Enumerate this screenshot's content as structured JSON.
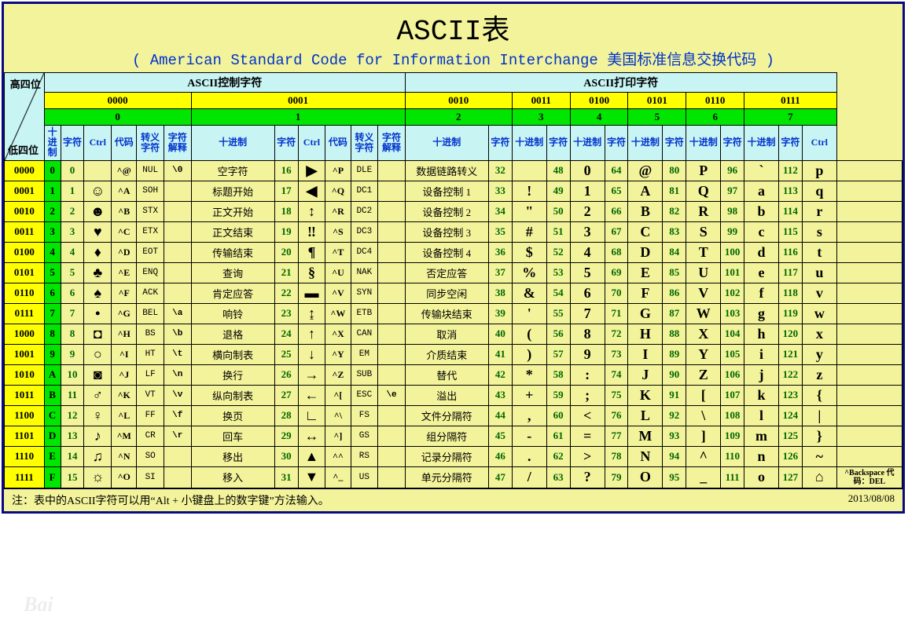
{
  "title": "ASCII表",
  "subtitle": "( American Standard Code for Information Interchange  美国标准信息交换代码 )",
  "corner_hi": "高四位",
  "corner_lo": "低四位",
  "section_control": "ASCII控制字符",
  "section_print": "ASCII打印字符",
  "bins": [
    "0000",
    "0001",
    "0010",
    "0011",
    "0100",
    "0101",
    "0110",
    "0111"
  ],
  "hexes": [
    "0",
    "1",
    "2",
    "3",
    "4",
    "5",
    "6",
    "7"
  ],
  "h": {
    "dec": "十进制",
    "char": "字符",
    "ctrl": "Ctrl",
    "code": "代码",
    "esc": "转义字符",
    "desc": "字符解释"
  },
  "rows_meta": [
    {
      "bin": "0000",
      "hex": "0"
    },
    {
      "bin": "0001",
      "hex": "1"
    },
    {
      "bin": "0010",
      "hex": "2"
    },
    {
      "bin": "0011",
      "hex": "3"
    },
    {
      "bin": "0100",
      "hex": "4"
    },
    {
      "bin": "0101",
      "hex": "5"
    },
    {
      "bin": "0110",
      "hex": "6"
    },
    {
      "bin": "0111",
      "hex": "7"
    },
    {
      "bin": "1000",
      "hex": "8"
    },
    {
      "bin": "1001",
      "hex": "9"
    },
    {
      "bin": "1010",
      "hex": "A"
    },
    {
      "bin": "1011",
      "hex": "B"
    },
    {
      "bin": "1100",
      "hex": "C"
    },
    {
      "bin": "1101",
      "hex": "D"
    },
    {
      "bin": "1110",
      "hex": "E"
    },
    {
      "bin": "1111",
      "hex": "F"
    }
  ],
  "col0": [
    {
      "d": 0,
      "g": "",
      "c": "^@",
      "cd": "NUL",
      "e": "\\0",
      "ds": "空字符"
    },
    {
      "d": 1,
      "g": "☺",
      "c": "^A",
      "cd": "SOH",
      "e": "",
      "ds": "标题开始"
    },
    {
      "d": 2,
      "g": "☻",
      "c": "^B",
      "cd": "STX",
      "e": "",
      "ds": "正文开始"
    },
    {
      "d": 3,
      "g": "♥",
      "c": "^C",
      "cd": "ETX",
      "e": "",
      "ds": "正文结束"
    },
    {
      "d": 4,
      "g": "♦",
      "c": "^D",
      "cd": "EOT",
      "e": "",
      "ds": "传输结束"
    },
    {
      "d": 5,
      "g": "♣",
      "c": "^E",
      "cd": "ENQ",
      "e": "",
      "ds": "查询"
    },
    {
      "d": 6,
      "g": "♠",
      "c": "^F",
      "cd": "ACK",
      "e": "",
      "ds": "肯定应答"
    },
    {
      "d": 7,
      "g": "•",
      "c": "^G",
      "cd": "BEL",
      "e": "\\a",
      "ds": "响铃"
    },
    {
      "d": 8,
      "g": "◘",
      "c": "^H",
      "cd": "BS",
      "e": "\\b",
      "ds": "退格"
    },
    {
      "d": 9,
      "g": "○",
      "c": "^I",
      "cd": "HT",
      "e": "\\t",
      "ds": "横向制表"
    },
    {
      "d": 10,
      "g": "◙",
      "c": "^J",
      "cd": "LF",
      "e": "\\n",
      "ds": "换行"
    },
    {
      "d": 11,
      "g": "♂",
      "c": "^K",
      "cd": "VT",
      "e": "\\v",
      "ds": "纵向制表"
    },
    {
      "d": 12,
      "g": "♀",
      "c": "^L",
      "cd": "FF",
      "e": "\\f",
      "ds": "换页"
    },
    {
      "d": 13,
      "g": "♪",
      "c": "^M",
      "cd": "CR",
      "e": "\\r",
      "ds": "回车"
    },
    {
      "d": 14,
      "g": "♫",
      "c": "^N",
      "cd": "SO",
      "e": "",
      "ds": "移出"
    },
    {
      "d": 15,
      "g": "☼",
      "c": "^O",
      "cd": "SI",
      "e": "",
      "ds": "移入"
    }
  ],
  "col1": [
    {
      "d": 16,
      "g": "▶",
      "c": "^P",
      "cd": "DLE",
      "e": "",
      "ds": "数据链路转义"
    },
    {
      "d": 17,
      "g": "◀",
      "c": "^Q",
      "cd": "DC1",
      "e": "",
      "ds": "设备控制 1"
    },
    {
      "d": 18,
      "g": "↕",
      "c": "^R",
      "cd": "DC2",
      "e": "",
      "ds": "设备控制 2"
    },
    {
      "d": 19,
      "g": "‼",
      "c": "^S",
      "cd": "DC3",
      "e": "",
      "ds": "设备控制 3"
    },
    {
      "d": 20,
      "g": "¶",
      "c": "^T",
      "cd": "DC4",
      "e": "",
      "ds": "设备控制 4"
    },
    {
      "d": 21,
      "g": "§",
      "c": "^U",
      "cd": "NAK",
      "e": "",
      "ds": "否定应答"
    },
    {
      "d": 22,
      "g": "▬",
      "c": "^V",
      "cd": "SYN",
      "e": "",
      "ds": "同步空闲"
    },
    {
      "d": 23,
      "g": "↨",
      "c": "^W",
      "cd": "ETB",
      "e": "",
      "ds": "传输块结束"
    },
    {
      "d": 24,
      "g": "↑",
      "c": "^X",
      "cd": "CAN",
      "e": "",
      "ds": "取消"
    },
    {
      "d": 25,
      "g": "↓",
      "c": "^Y",
      "cd": "EM",
      "e": "",
      "ds": "介质结束"
    },
    {
      "d": 26,
      "g": "→",
      "c": "^Z",
      "cd": "SUB",
      "e": "",
      "ds": "替代"
    },
    {
      "d": 27,
      "g": "←",
      "c": "^[",
      "cd": "ESC",
      "e": "\\e",
      "ds": "溢出"
    },
    {
      "d": 28,
      "g": "∟",
      "c": "^\\",
      "cd": "FS",
      "e": "",
      "ds": "文件分隔符"
    },
    {
      "d": 29,
      "g": "↔",
      "c": "^]",
      "cd": "GS",
      "e": "",
      "ds": "组分隔符"
    },
    {
      "d": 30,
      "g": "▲",
      "c": "^^",
      "cd": "RS",
      "e": "",
      "ds": "记录分隔符"
    },
    {
      "d": 31,
      "g": "▼",
      "c": "^_",
      "cd": "US",
      "e": "",
      "ds": "单元分隔符"
    }
  ],
  "col2": [
    {
      "d": 32,
      "g": ""
    },
    {
      "d": 33,
      "g": "!"
    },
    {
      "d": 34,
      "g": "\""
    },
    {
      "d": 35,
      "g": "#"
    },
    {
      "d": 36,
      "g": "$"
    },
    {
      "d": 37,
      "g": "%"
    },
    {
      "d": 38,
      "g": "&"
    },
    {
      "d": 39,
      "g": "'"
    },
    {
      "d": 40,
      "g": "("
    },
    {
      "d": 41,
      "g": ")"
    },
    {
      "d": 42,
      "g": "*"
    },
    {
      "d": 43,
      "g": "+"
    },
    {
      "d": 44,
      "g": ","
    },
    {
      "d": 45,
      "g": "-"
    },
    {
      "d": 46,
      "g": "."
    },
    {
      "d": 47,
      "g": "/"
    }
  ],
  "col3": [
    {
      "d": 48,
      "g": "0"
    },
    {
      "d": 49,
      "g": "1"
    },
    {
      "d": 50,
      "g": "2"
    },
    {
      "d": 51,
      "g": "3"
    },
    {
      "d": 52,
      "g": "4"
    },
    {
      "d": 53,
      "g": "5"
    },
    {
      "d": 54,
      "g": "6"
    },
    {
      "d": 55,
      "g": "7"
    },
    {
      "d": 56,
      "g": "8"
    },
    {
      "d": 57,
      "g": "9"
    },
    {
      "d": 58,
      "g": ":"
    },
    {
      "d": 59,
      "g": ";"
    },
    {
      "d": 60,
      "g": "<"
    },
    {
      "d": 61,
      "g": "="
    },
    {
      "d": 62,
      "g": ">"
    },
    {
      "d": 63,
      "g": "?"
    }
  ],
  "col4": [
    {
      "d": 64,
      "g": "@"
    },
    {
      "d": 65,
      "g": "A"
    },
    {
      "d": 66,
      "g": "B"
    },
    {
      "d": 67,
      "g": "C"
    },
    {
      "d": 68,
      "g": "D"
    },
    {
      "d": 69,
      "g": "E"
    },
    {
      "d": 70,
      "g": "F"
    },
    {
      "d": 71,
      "g": "G"
    },
    {
      "d": 72,
      "g": "H"
    },
    {
      "d": 73,
      "g": "I"
    },
    {
      "d": 74,
      "g": "J"
    },
    {
      "d": 75,
      "g": "K"
    },
    {
      "d": 76,
      "g": "L"
    },
    {
      "d": 77,
      "g": "M"
    },
    {
      "d": 78,
      "g": "N"
    },
    {
      "d": 79,
      "g": "O"
    }
  ],
  "col5": [
    {
      "d": 80,
      "g": "P"
    },
    {
      "d": 81,
      "g": "Q"
    },
    {
      "d": 82,
      "g": "R"
    },
    {
      "d": 83,
      "g": "S"
    },
    {
      "d": 84,
      "g": "T"
    },
    {
      "d": 85,
      "g": "U"
    },
    {
      "d": 86,
      "g": "V"
    },
    {
      "d": 87,
      "g": "W"
    },
    {
      "d": 88,
      "g": "X"
    },
    {
      "d": 89,
      "g": "Y"
    },
    {
      "d": 90,
      "g": "Z"
    },
    {
      "d": 91,
      "g": "["
    },
    {
      "d": 92,
      "g": "\\"
    },
    {
      "d": 93,
      "g": "]"
    },
    {
      "d": 94,
      "g": "^"
    },
    {
      "d": 95,
      "g": "_"
    }
  ],
  "col6": [
    {
      "d": 96,
      "g": "`"
    },
    {
      "d": 97,
      "g": "a"
    },
    {
      "d": 98,
      "g": "b"
    },
    {
      "d": 99,
      "g": "c"
    },
    {
      "d": 100,
      "g": "d"
    },
    {
      "d": 101,
      "g": "e"
    },
    {
      "d": 102,
      "g": "f"
    },
    {
      "d": 103,
      "g": "g"
    },
    {
      "d": 104,
      "g": "h"
    },
    {
      "d": 105,
      "g": "i"
    },
    {
      "d": 106,
      "g": "j"
    },
    {
      "d": 107,
      "g": "k"
    },
    {
      "d": 108,
      "g": "l"
    },
    {
      "d": 109,
      "g": "m"
    },
    {
      "d": 110,
      "g": "n"
    },
    {
      "d": 111,
      "g": "o"
    }
  ],
  "col7": [
    {
      "d": 112,
      "g": "p",
      "c": ""
    },
    {
      "d": 113,
      "g": "q",
      "c": ""
    },
    {
      "d": 114,
      "g": "r",
      "c": ""
    },
    {
      "d": 115,
      "g": "s",
      "c": ""
    },
    {
      "d": 116,
      "g": "t",
      "c": ""
    },
    {
      "d": 117,
      "g": "u",
      "c": ""
    },
    {
      "d": 118,
      "g": "v",
      "c": ""
    },
    {
      "d": 119,
      "g": "w",
      "c": ""
    },
    {
      "d": 120,
      "g": "x",
      "c": ""
    },
    {
      "d": 121,
      "g": "y",
      "c": ""
    },
    {
      "d": 122,
      "g": "z",
      "c": ""
    },
    {
      "d": 123,
      "g": "{",
      "c": ""
    },
    {
      "d": 124,
      "g": "|",
      "c": ""
    },
    {
      "d": 125,
      "g": "}",
      "c": ""
    },
    {
      "d": 126,
      "g": "~",
      "c": ""
    },
    {
      "d": 127,
      "g": "⌂",
      "c": "^Backspace 代码：DEL"
    }
  ],
  "note": "注：表中的ASCII字符可以用“Alt + 小键盘上的数字键”方法输入。",
  "date": "2013/08/08"
}
